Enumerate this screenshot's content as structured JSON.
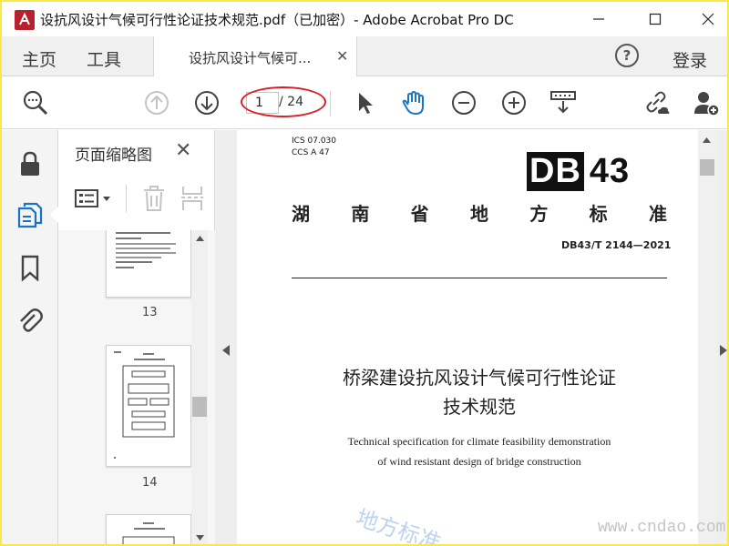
{
  "window": {
    "title": "设抗风设计气候可行性论证技术规范.pdf（已加密）- Adobe Acrobat Pro DC",
    "icon": "acrobat-app-icon"
  },
  "tabs": {
    "home": "主页",
    "tools": "工具",
    "document": "设抗风设计气候可...",
    "help": "?",
    "login": "登录"
  },
  "toolbar": {
    "current_page": "1",
    "total_pages": "/ 24"
  },
  "panel": {
    "title": "页面缩略图",
    "thumbnails": [
      {
        "number": "13"
      },
      {
        "number": "14"
      }
    ]
  },
  "document": {
    "ics": "ICS 07.030",
    "ccs": "CCS A 47",
    "logo_prefix": "DB",
    "logo_number": "43",
    "province": [
      "湖",
      "南",
      "省",
      "地",
      "方",
      "标",
      "准"
    ],
    "standard_no": "DB43/T 2144—2021",
    "title_cn_line1": "桥梁建设抗风设计气候可行性论证",
    "title_cn_line2": "技术规范",
    "title_en_line1": "Technical specification for climate feasibility demonstration",
    "title_en_line2": "of wind resistant design of bridge construction",
    "watermark": "地方标准",
    "site": "www.cndao.com"
  },
  "colors": {
    "accent_blue": "#1a73c8",
    "annotation_red": "#d71f26",
    "frame_yellow": "#f7e94a"
  }
}
